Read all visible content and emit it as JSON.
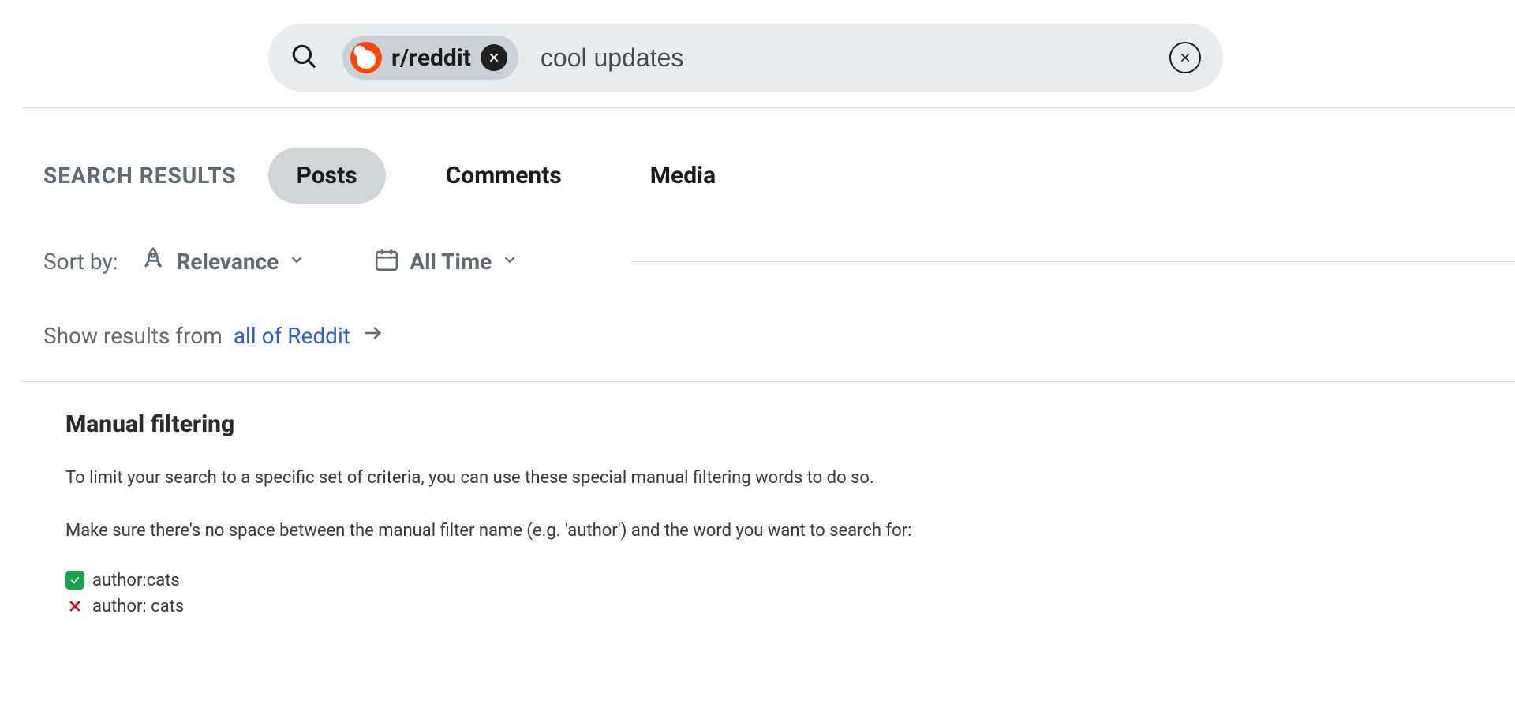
{
  "search": {
    "scope_label": "r/reddit",
    "query": "cool updates"
  },
  "results_header": "SEARCH RESULTS",
  "tabs": [
    {
      "label": "Posts",
      "active": true
    },
    {
      "label": "Comments",
      "active": false
    },
    {
      "label": "Media",
      "active": false
    }
  ],
  "sort": {
    "label": "Sort by:",
    "value": "Relevance",
    "time_value": "All Time"
  },
  "show_results": {
    "prefix": "Show results from",
    "link": "all of Reddit"
  },
  "manual_filtering": {
    "heading": "Manual filtering",
    "para1": "To limit your search to a specific set of criteria, you can use these special manual filtering words to do so.",
    "para2": "Make sure there's no space between the manual filter name (e.g. 'author') and the word you want to search for:",
    "example_ok": "author:cats",
    "example_bad": "author: cats"
  }
}
